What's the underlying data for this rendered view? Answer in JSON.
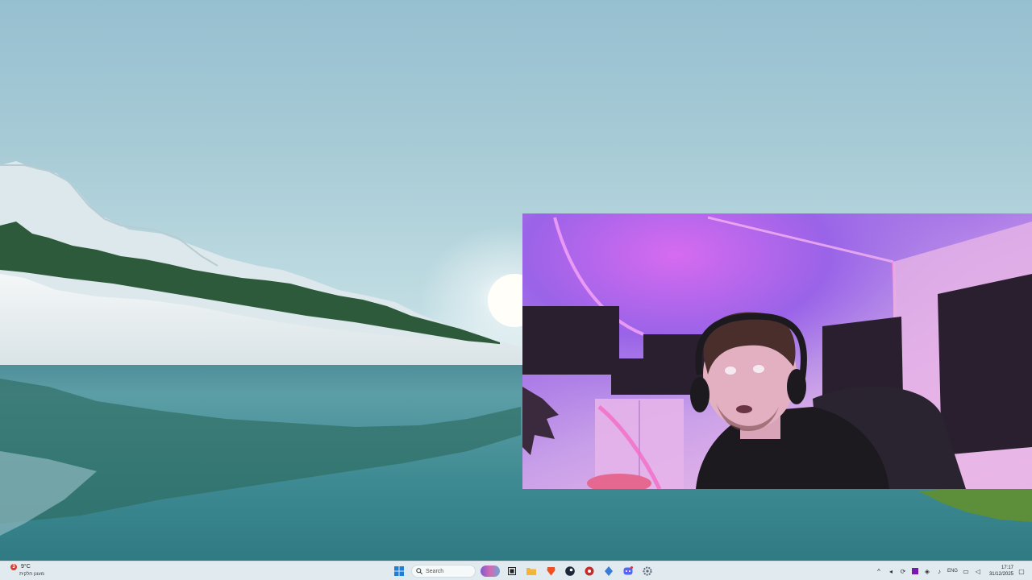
{
  "taskbar": {
    "weather": {
      "badge": "3",
      "temp": "9°C",
      "desc": "מעונן חלקית"
    },
    "start": {
      "icon": "windows-start-icon"
    },
    "search": {
      "label": "Search",
      "icon": "search-icon"
    },
    "apps": [
      {
        "name": "copilot",
        "icon": "copilot-icon"
      },
      {
        "name": "task-view",
        "icon": "task-view-icon"
      },
      {
        "name": "file-explorer",
        "icon": "folder-icon",
        "color": "#f2b53a"
      },
      {
        "name": "brave",
        "icon": "brave-lion-icon",
        "color": "#f04e23"
      },
      {
        "name": "steam",
        "icon": "steam-icon",
        "color": "#1b2838"
      },
      {
        "name": "app-red",
        "icon": "red-app-icon",
        "color": "#c42b2b"
      },
      {
        "name": "app-blue",
        "icon": "blue-diamond-icon",
        "color": "#3a7bd5"
      },
      {
        "name": "discord",
        "icon": "discord-icon",
        "color": "#5865f2"
      },
      {
        "name": "settings",
        "icon": "gear-icon",
        "color": "#5a6a78"
      }
    ],
    "tray": {
      "lang": "ENG",
      "time": "17:17",
      "date": "31/12/2025"
    }
  }
}
